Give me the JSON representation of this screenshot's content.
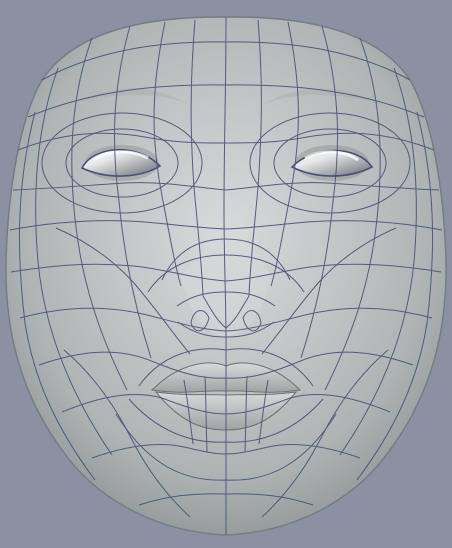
{
  "scene": {
    "subject": "face-wireframe-mesh",
    "colors": {
      "background": "#8b91a3",
      "skin": "#b9bcbc",
      "skin_highlight": "#dcdede",
      "skin_shadow": "#8f9596",
      "mesh_line": "#4a4f79",
      "eye_highlight": "#ffffff",
      "eye_shadow": "#6f747a"
    },
    "icons": {
      "left_eye": "eye-icon",
      "right_eye": "eye-icon"
    }
  }
}
